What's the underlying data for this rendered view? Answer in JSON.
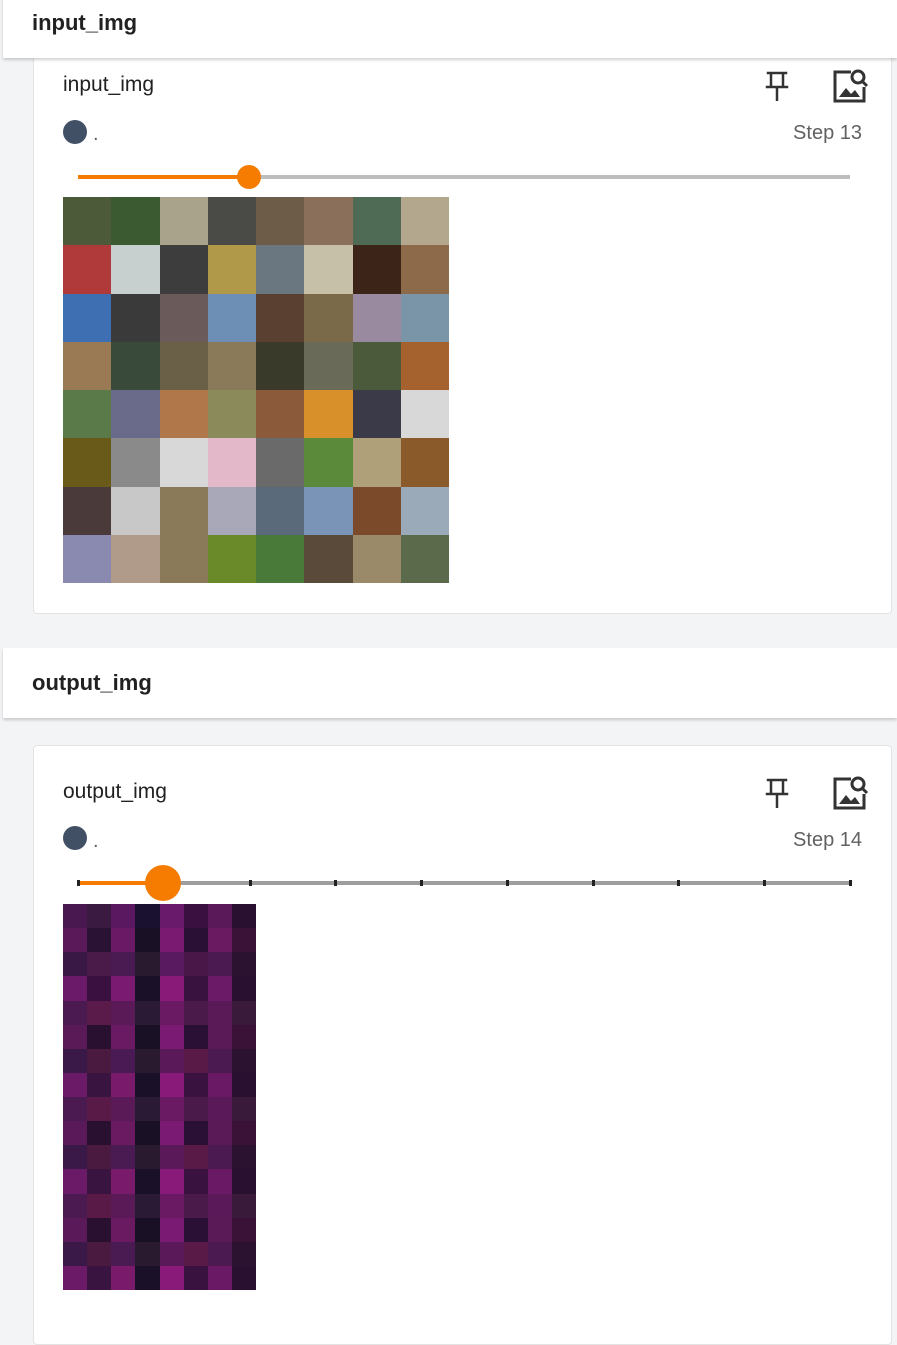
{
  "sections": [
    {
      "header": "input_img",
      "card": {
        "title": "input_img",
        "run_label": ".",
        "step_text": "Step 13",
        "slider_fraction": 0.222,
        "image": {
          "cols": 8,
          "rows": 8,
          "colors": [
            "#4d5a3a",
            "#3c5a32",
            "#a9a38c",
            "#4a4a46",
            "#6c5c48",
            "#8a6f5a",
            "#4f6b56",
            "#b3a88d",
            "#b03a3a",
            "#c8cfcf",
            "#3d3d3d",
            "#b09a4a",
            "#6a7680",
            "#c7c0a8",
            "#3d2418",
            "#8c6a4a",
            "#3f6fb3",
            "#3a3a3a",
            "#6a5a5a",
            "#6d8fb5",
            "#5a4030",
            "#7a6a4a",
            "#9a8aa0",
            "#7a95a8",
            "#9a7a55",
            "#3a4a3a",
            "#6a6048",
            "#8a7a5a",
            "#3a3a2a",
            "#6a6a58",
            "#4a5a3a",
            "#a5622e",
            "#5a7a4a",
            "#6a6a8a",
            "#b0784a",
            "#8a8a5a",
            "#8a5a3a",
            "#d8902a",
            "#3a3a48",
            "#d8d8d8",
            "#6a5a1a",
            "#8a8a8a",
            "#d8d8d8",
            "#e3b8c8",
            "#6a6a6a",
            "#5a8a3a",
            "#b0a07a",
            "#8a5a2a",
            "#4a3a3a",
            "#c8c8c8",
            "#8a7a5a",
            "#a8a8b8",
            "#5a6a7a",
            "#7a94b8",
            "#7a4a2a",
            "#9aaab8",
            "#8a8ab0",
            "#b09a8a",
            "#8a7a5a",
            "#6a8a2a",
            "#4a7a3a",
            "#5a4a3a",
            "#9a8a6a",
            "#5a6a4a"
          ]
        }
      }
    },
    {
      "header": "output_img",
      "card": {
        "title": "output_img",
        "run_label": ".",
        "step_text": "Step 14",
        "slider_fraction": 0.11,
        "slider_ticks": 9,
        "image": {
          "cols": 8,
          "rows": 16,
          "colors": [
            "#4a1850",
            "#3a1a40",
            "#5a1860",
            "#1a1030",
            "#6a1a6a",
            "#3a1040",
            "#5a1a5a",
            "#2a1030",
            "#5a1a5a",
            "#2a1235",
            "#6a1a65",
            "#1a1025",
            "#7a1a70",
            "#2a1035",
            "#6a1a60",
            "#3a1238",
            "#3a1845",
            "#4a1a48",
            "#4a1a52",
            "#2a1a30",
            "#5a1a60",
            "#4a1848",
            "#4a1a50",
            "#2a1230",
            "#6a1a68",
            "#3a1040",
            "#7a1a70",
            "#1a1028",
            "#8a1a78",
            "#3a1240",
            "#6a1a66",
            "#2a1030",
            "#4a1a50",
            "#5a1a4a",
            "#5a1a58",
            "#2a1a35",
            "#6a1a62",
            "#4a1a4a",
            "#5a1a58",
            "#3a1a3a",
            "#5a1a58",
            "#2a1030",
            "#6a1a62",
            "#1a1025",
            "#7a1a72",
            "#2a1035",
            "#5a1a58",
            "#3a1238",
            "#3a1848",
            "#4a1a40",
            "#4a1a55",
            "#2a1a30",
            "#5a1a5a",
            "#5a1a48",
            "#4a1a50",
            "#2a1230",
            "#6a1a66",
            "#3a1440",
            "#7a1a6a",
            "#1a1028",
            "#8a1a7a",
            "#3a1240",
            "#6a1a64",
            "#2a1030",
            "#4a1a50",
            "#5a1a48",
            "#5a1a58",
            "#2a1a35",
            "#6a1a62",
            "#4a1a4a",
            "#5a1a5a",
            "#3a1a3a",
            "#5a1a5a",
            "#2a1030",
            "#6a1a60",
            "#1a1025",
            "#7a1a72",
            "#2a1035",
            "#5a1a58",
            "#3a1238",
            "#3a1848",
            "#4a1a40",
            "#4a1a52",
            "#2a1a30",
            "#5a1a5a",
            "#5a1a48",
            "#4a1a50",
            "#2a1230",
            "#6a1a66",
            "#3a1440",
            "#7a1a6a",
            "#1a1028",
            "#8a1a7a",
            "#3a1240",
            "#6a1a64",
            "#2a1030",
            "#4a1a50",
            "#5a1a48",
            "#5a1a58",
            "#2a1a35",
            "#6a1a62",
            "#4a1a4a",
            "#5a1a5a",
            "#3a1a3a",
            "#5a1a5a",
            "#2a1030",
            "#6a1a60",
            "#1a1025",
            "#7a1a72",
            "#2a1035",
            "#5a1a58",
            "#3a1238",
            "#3a1848",
            "#4a1a40",
            "#4a1a52",
            "#2a1a30",
            "#5a1a5a",
            "#5a1a48",
            "#4a1a50",
            "#2a1230",
            "#6a1a66",
            "#3a1440",
            "#7a1a6a",
            "#1a1028",
            "#8a1a7a",
            "#3a1240",
            "#6a1a64",
            "#2a1030"
          ]
        }
      }
    }
  ],
  "icons": {
    "pin": "pin-icon",
    "explore": "image-search-icon"
  },
  "colors": {
    "accent": "#f57c00",
    "run_color": "#425066",
    "track": "#bdbdbd"
  }
}
